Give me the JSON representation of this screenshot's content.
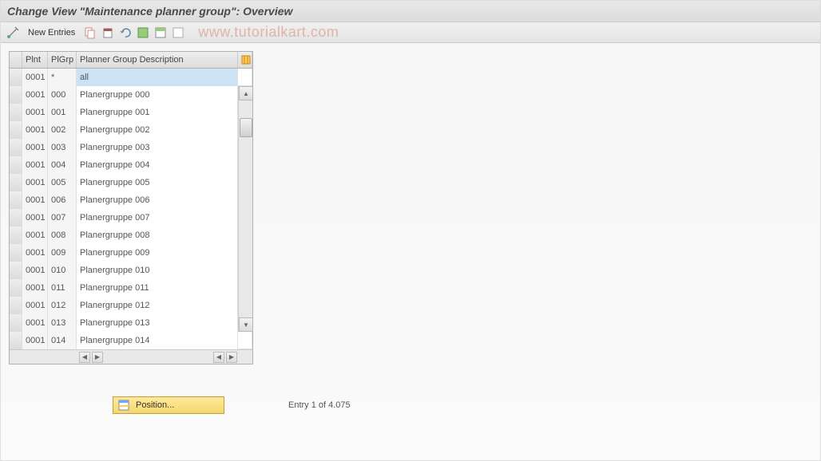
{
  "title": "Change View \"Maintenance planner group\": Overview",
  "toolbar": {
    "new_entries_label": "New Entries"
  },
  "watermark": "www.tutorialkart.com",
  "table": {
    "headers": {
      "plnt": "Plnt",
      "plgrp": "PlGrp",
      "desc": "Planner Group Description"
    },
    "rows": [
      {
        "plnt": "0001",
        "plgrp": "*",
        "desc": "all"
      },
      {
        "plnt": "0001",
        "plgrp": "000",
        "desc": "Planergruppe 000"
      },
      {
        "plnt": "0001",
        "plgrp": "001",
        "desc": "Planergruppe 001"
      },
      {
        "plnt": "0001",
        "plgrp": "002",
        "desc": "Planergruppe 002"
      },
      {
        "plnt": "0001",
        "plgrp": "003",
        "desc": "Planergruppe 003"
      },
      {
        "plnt": "0001",
        "plgrp": "004",
        "desc": "Planergruppe 004"
      },
      {
        "plnt": "0001",
        "plgrp": "005",
        "desc": "Planergruppe 005"
      },
      {
        "plnt": "0001",
        "plgrp": "006",
        "desc": "Planergruppe 006"
      },
      {
        "plnt": "0001",
        "plgrp": "007",
        "desc": "Planergruppe 007"
      },
      {
        "plnt": "0001",
        "plgrp": "008",
        "desc": "Planergruppe 008"
      },
      {
        "plnt": "0001",
        "plgrp": "009",
        "desc": "Planergruppe 009"
      },
      {
        "plnt": "0001",
        "plgrp": "010",
        "desc": "Planergruppe 010"
      },
      {
        "plnt": "0001",
        "plgrp": "011",
        "desc": "Planergruppe 011"
      },
      {
        "plnt": "0001",
        "plgrp": "012",
        "desc": "Planergruppe 012"
      },
      {
        "plnt": "0001",
        "plgrp": "013",
        "desc": "Planergruppe 013"
      },
      {
        "plnt": "0001",
        "plgrp": "014",
        "desc": "Planergruppe 014"
      }
    ]
  },
  "footer": {
    "position_label": "Position...",
    "entry_label": "Entry 1 of 4.075"
  },
  "highlighted_row": 0
}
